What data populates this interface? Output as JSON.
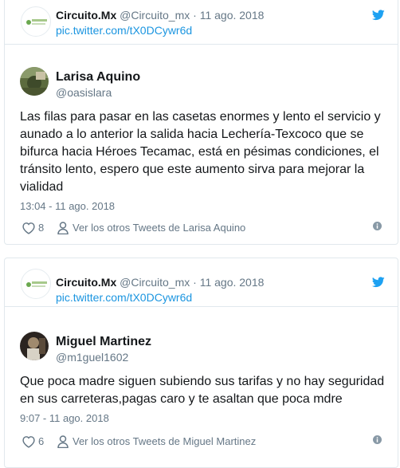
{
  "tweets": [
    {
      "quoted": {
        "name": "Circuito.Mx",
        "handle": "@Circuito_mx",
        "separator": "·",
        "date": "11 ago. 2018",
        "link": "pic.twitter.com/tX0DCywr6d"
      },
      "author": {
        "name": "Larisa Aquino",
        "handle": "@oasislara"
      },
      "text": "Las filas para pasar en las casetas enormes y lento el servicio y aunado a lo anterior la salida hacia Lechería-Texcoco que se bifurca hacia Héroes Tecamac, está en pésimas condiciones, el tránsito lento, espero que este aumento sirva para mejorar la vialidad",
      "timestamp": "13:04 - 11 ago. 2018",
      "likes": "8",
      "profile_link": "Ver los otros Tweets de Larisa Aquino"
    },
    {
      "quoted": {
        "name": "Circuito.Mx",
        "handle": "@Circuito_mx",
        "separator": "·",
        "date": "11 ago. 2018",
        "link": "pic.twitter.com/tX0DCywr6d"
      },
      "author": {
        "name": "Miguel Martinez",
        "handle": "@m1guel1602"
      },
      "text": "Que poca madre siguen subiendo sus tarifas y no hay seguridad en sus carreteras,pagas caro y te asaltan que poca mdre",
      "timestamp": "9:07 - 11 ago. 2018",
      "likes": "6",
      "profile_link": "Ver los otros Tweets de Miguel Martinez"
    }
  ],
  "colors": {
    "link": "#1b95e0",
    "muted": "#657786",
    "border": "#e1e8ed",
    "text": "#14171a"
  },
  "icons": [
    "twitter-bird-icon",
    "heart-icon",
    "person-icon",
    "info-icon"
  ]
}
